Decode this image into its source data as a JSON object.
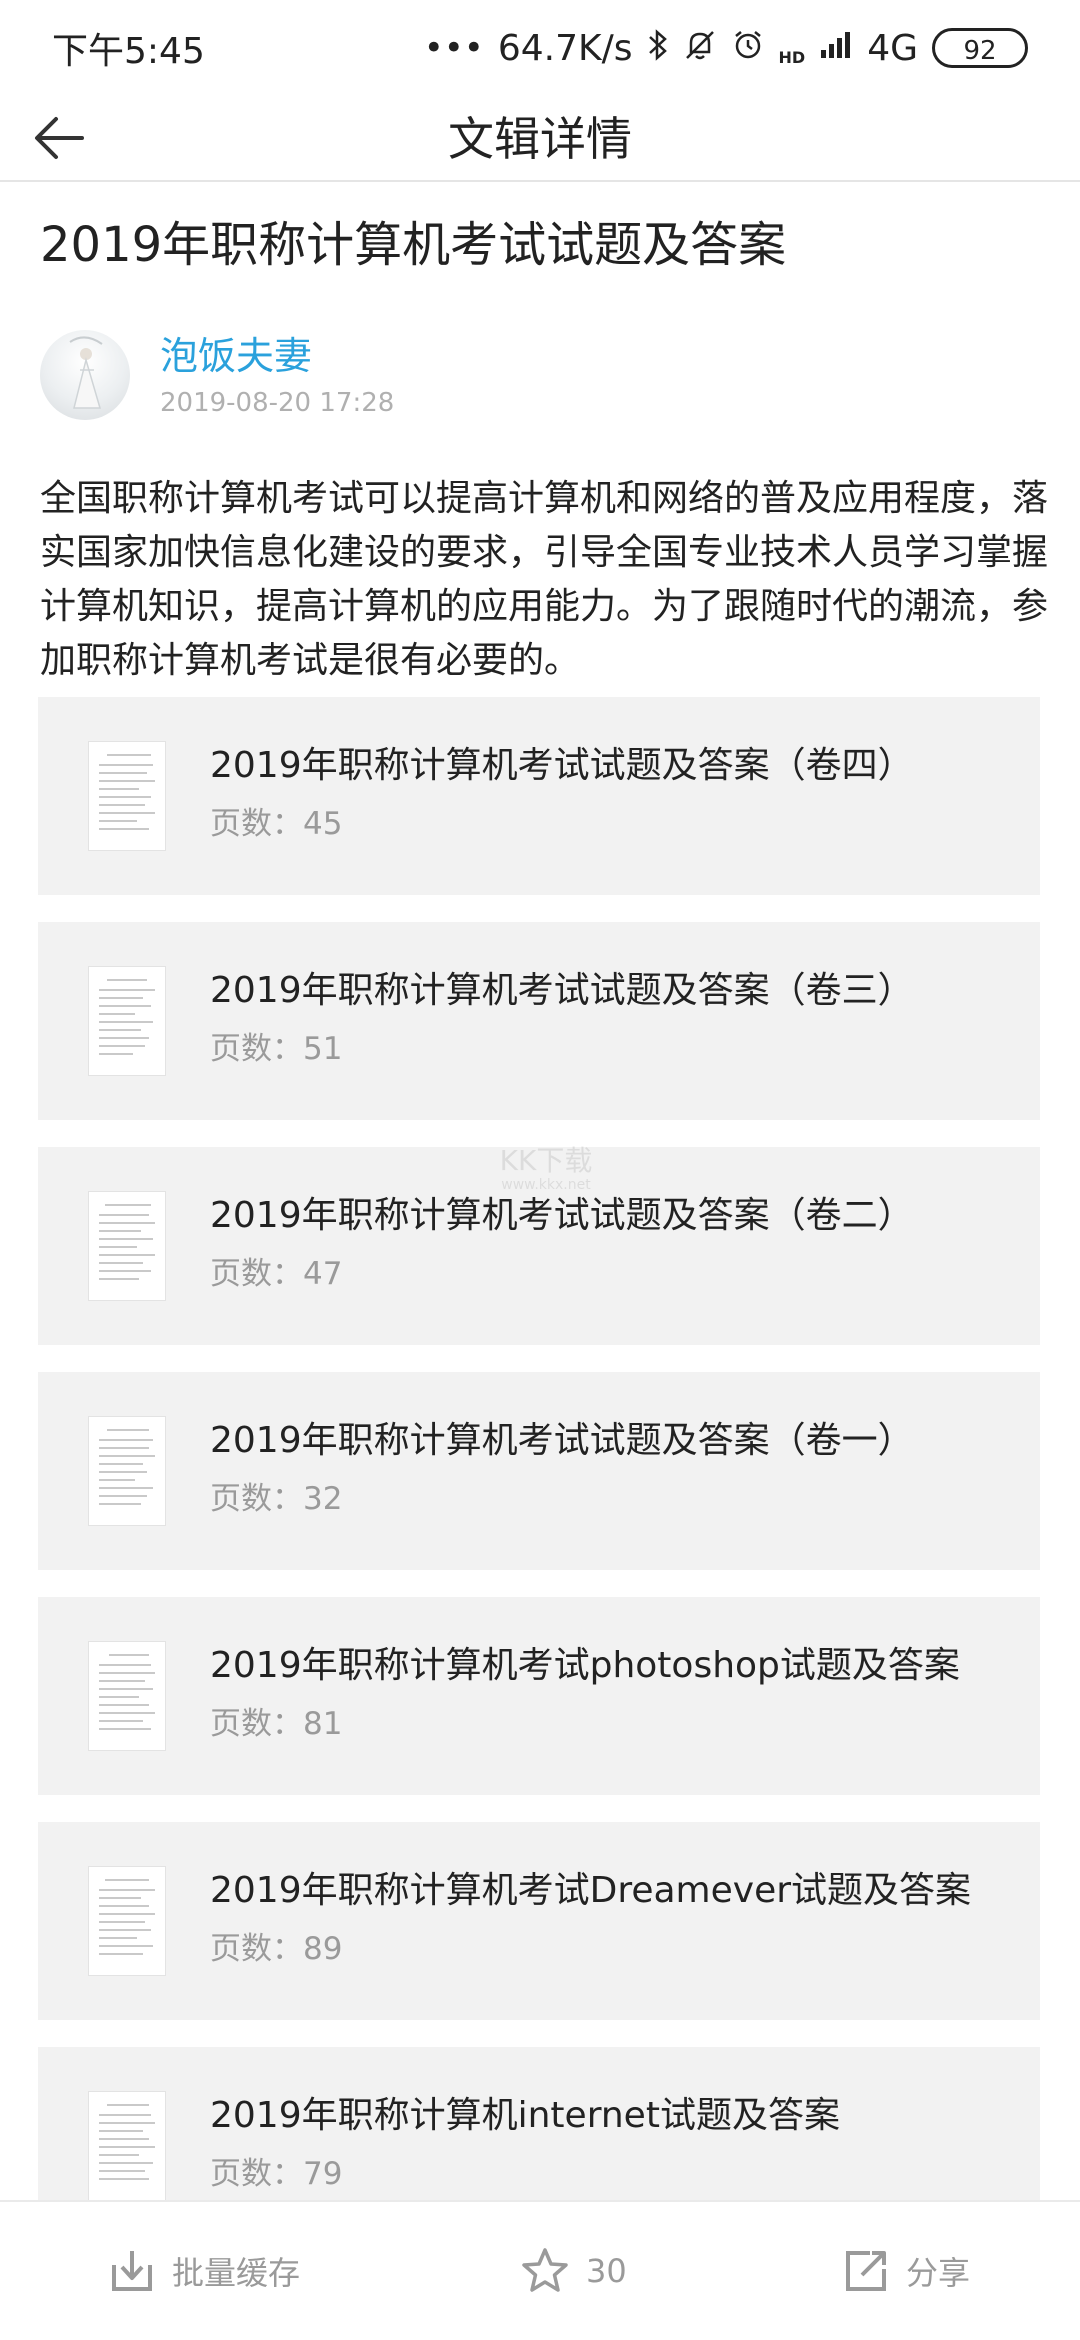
{
  "status_bar": {
    "time": "下午5:45",
    "network_speed": "64.7K/s",
    "hd_label": "HD",
    "network_type": "4G",
    "battery": "92"
  },
  "app_bar": {
    "title": "文辑详情"
  },
  "article": {
    "title": "2019年职称计算机考试试题及答案",
    "author": "泡饭夫妻",
    "date": "2019-08-20 17:28",
    "intro": "全国职称计算机考试可以提高计算机和网络的普及应用程度，落实国家加快信息化建设的要求，引导全国专业技术人员学习掌握计算机知识，提高计算机的应用能力。为了跟随时代的潮流，参加职称计算机考试是很有必要的。"
  },
  "documents": [
    {
      "title": "2019年职称计算机考试试题及答案（卷四）",
      "pages": "页数：45"
    },
    {
      "title": "2019年职称计算机考试试题及答案（卷三）",
      "pages": "页数：51"
    },
    {
      "title": "2019年职称计算机考试试题及答案（卷二）",
      "pages": "页数：47"
    },
    {
      "title": "2019年职称计算机考试试题及答案（卷一）",
      "pages": "页数：32"
    },
    {
      "title": "2019年职称计算机考试photoshop试题及答案",
      "pages": "页数：81"
    },
    {
      "title": "2019年职称计算机考试Dreamever试题及答案",
      "pages": "页数：89"
    },
    {
      "title": "2019年职称计算机internet试题及答案",
      "pages": "页数：79"
    }
  ],
  "watermark": {
    "text": "KK下载",
    "url": "www.kkx.net"
  },
  "bottom_bar": {
    "batch_cache_label": "批量缓存",
    "favorite_count": "30",
    "share_label": "分享"
  },
  "icons": {
    "back": "arrow-left-icon",
    "batch_cache": "download-icon",
    "favorite": "star-icon",
    "share": "share-icon"
  },
  "colors": {
    "author": "#2aa1dc",
    "card_background": "#f2f2f2",
    "muted_text": "#9a9a9a"
  }
}
